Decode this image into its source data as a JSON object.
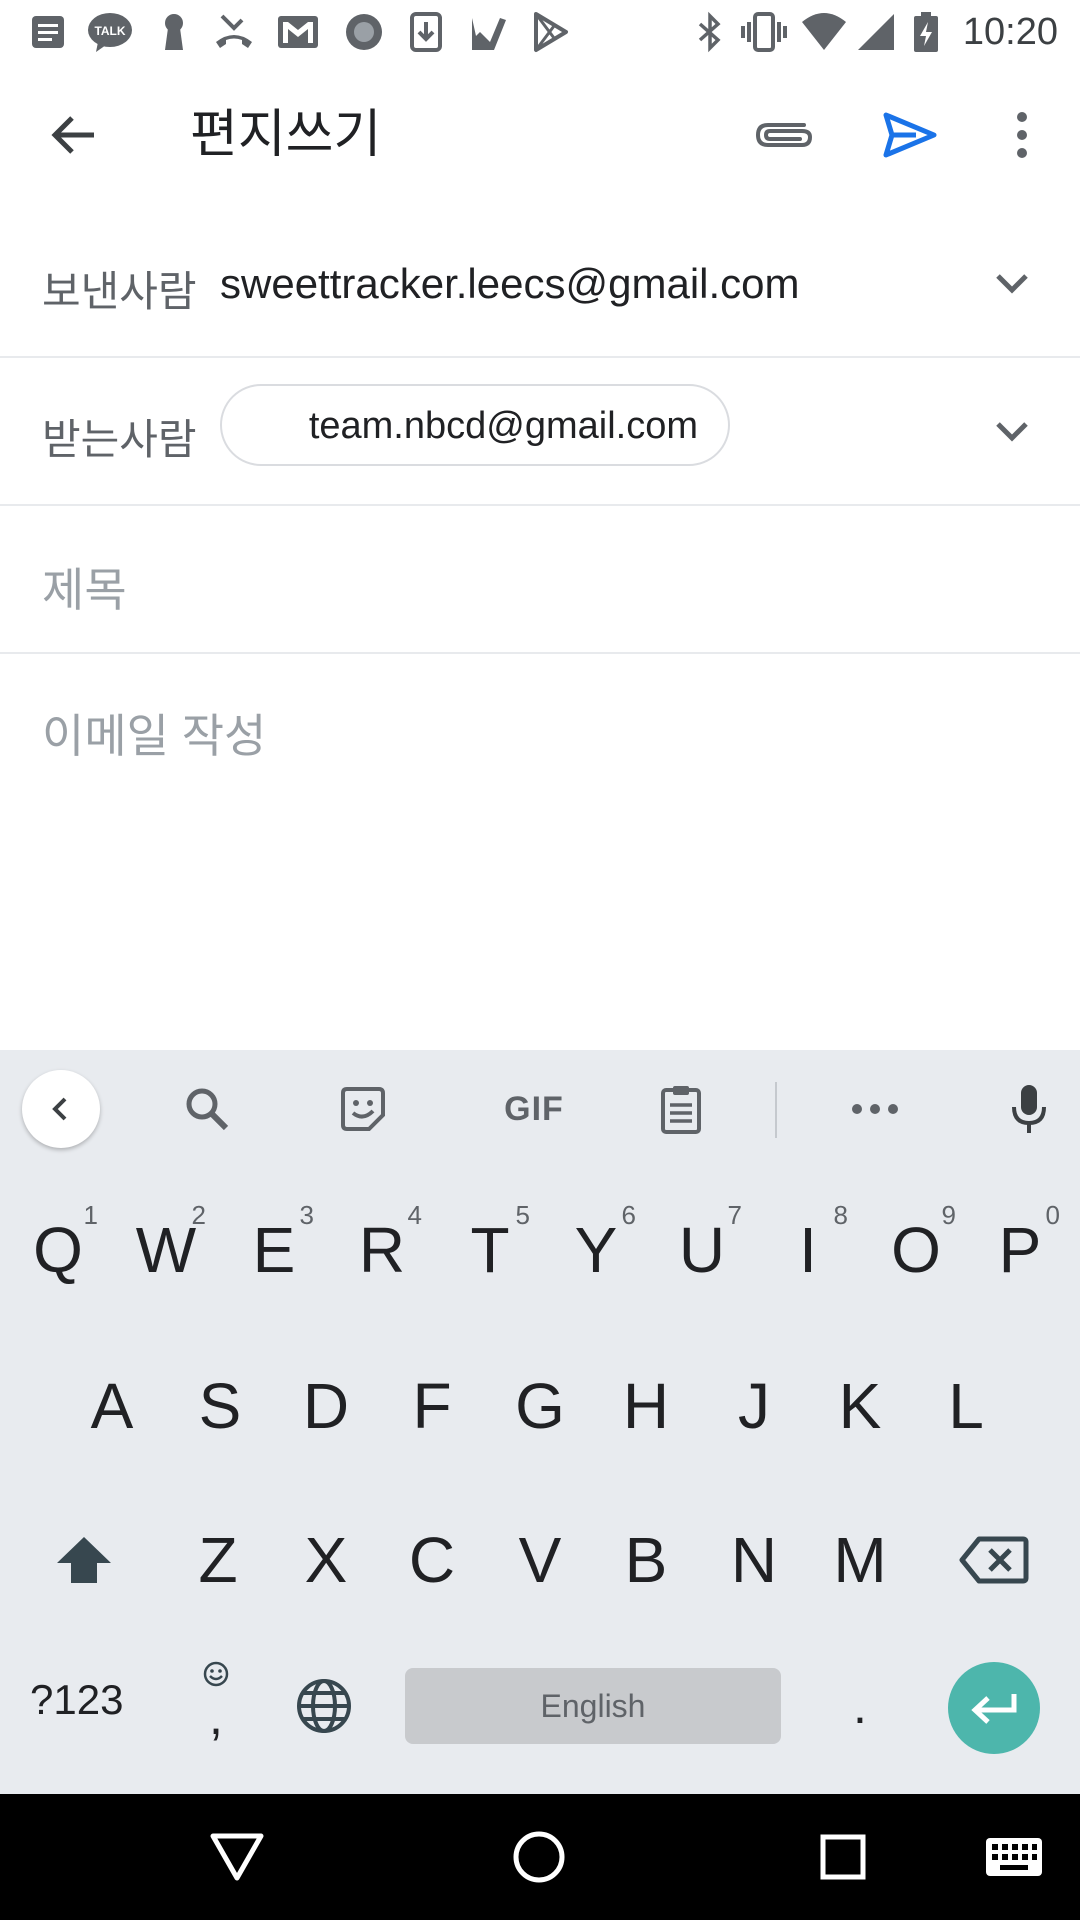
{
  "status_bar": {
    "time": "10:20",
    "left_icons": [
      "notes-icon",
      "kakaotalk-icon",
      "keyhole-icon",
      "missed-call-icon",
      "gmail-icon",
      "circle-app-icon",
      "download-icon",
      "check-icon",
      "play-store-icon"
    ],
    "kakao_label": "TALK",
    "right_icons": [
      "bluetooth-icon",
      "vibrate-icon",
      "wifi-icon",
      "signal-icon",
      "battery-charging-icon"
    ]
  },
  "app_bar": {
    "title": "편지쓰기",
    "accent_color": "#1a73e8"
  },
  "compose": {
    "from_label": "보낸사람",
    "from_value": "sweettracker.leecs@gmail.com",
    "to_label": "받는사람",
    "to_chip": "team.nbcd@gmail.com",
    "subject_placeholder": "제목",
    "body_placeholder": "이메일 작성"
  },
  "keyboard": {
    "toolbar_gif": "GIF",
    "row1": [
      {
        "key": "Q",
        "hint": "1"
      },
      {
        "key": "W",
        "hint": "2"
      },
      {
        "key": "E",
        "hint": "3"
      },
      {
        "key": "R",
        "hint": "4"
      },
      {
        "key": "T",
        "hint": "5"
      },
      {
        "key": "Y",
        "hint": "6"
      },
      {
        "key": "U",
        "hint": "7"
      },
      {
        "key": "I",
        "hint": "8"
      },
      {
        "key": "O",
        "hint": "9"
      },
      {
        "key": "P",
        "hint": "0"
      }
    ],
    "row2": [
      "A",
      "S",
      "D",
      "F",
      "G",
      "H",
      "J",
      "K",
      "L"
    ],
    "row3": [
      "Z",
      "X",
      "C",
      "V",
      "B",
      "N",
      "M"
    ],
    "symbols_key": "?123",
    "comma_key": ",",
    "space_label": "English",
    "period_key": ".",
    "enter_color": "#4db6ac"
  }
}
